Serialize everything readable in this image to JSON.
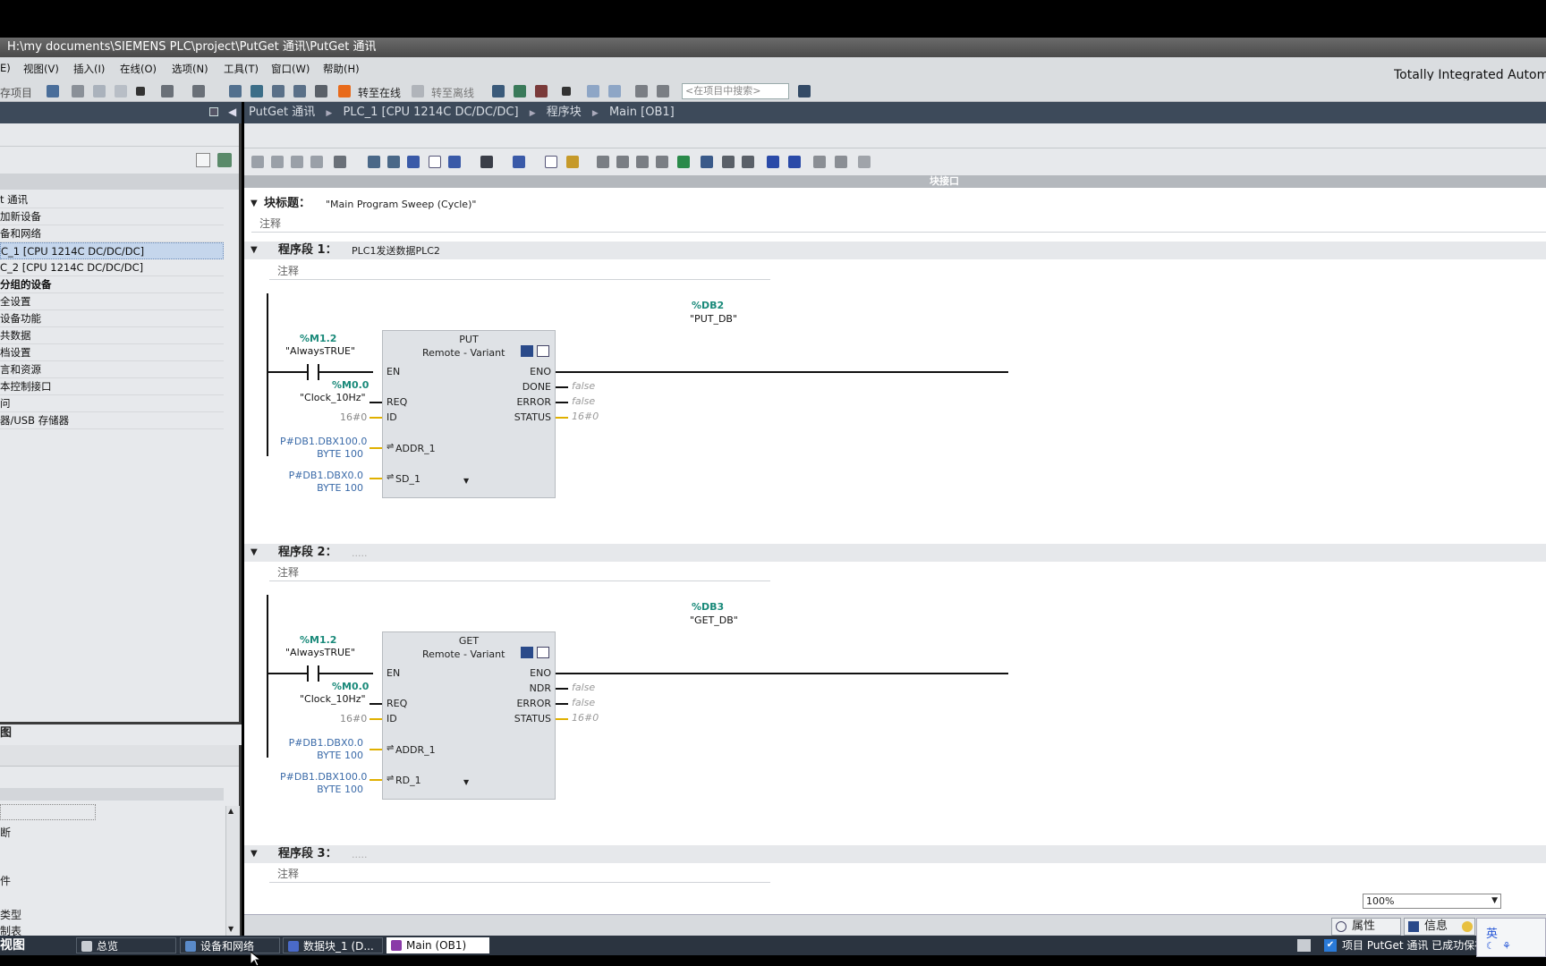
{
  "window": {
    "title": "H:\\my documents\\SIEMENS PLC\\project\\PutGet 通讯\\PutGet 通讯",
    "brand": "Totally Integrated Automation"
  },
  "menu": [
    "E)",
    "视图(V)",
    "插入(I)",
    "在线(O)",
    "选项(N)",
    "工具(T)",
    "窗口(W)",
    "帮助(H)"
  ],
  "toolbar": {
    "save_project": "存项目",
    "go_online": "转至在线",
    "go_offline": "转至离线",
    "search_placeholder": "<在项目中搜索>"
  },
  "breadcrumb": [
    "PutGet 通讯",
    "PLC_1 [CPU 1214C DC/DC/DC]",
    "程序块",
    "Main [OB1]"
  ],
  "tree": [
    {
      "label": "t 通讯"
    },
    {
      "label": "加新设备"
    },
    {
      "label": "备和网络"
    },
    {
      "label": "C_1 [CPU 1214C DC/DC/DC]",
      "selected": true
    },
    {
      "label": "C_2 [CPU 1214C DC/DC/DC]"
    },
    {
      "label": "分组的设备",
      "bold": true
    },
    {
      "label": "全设置"
    },
    {
      "label": "设备功能"
    },
    {
      "label": "共数据"
    },
    {
      "label": "档设置"
    },
    {
      "label": "言和资源"
    },
    {
      "label": "本控制接口"
    },
    {
      "label": "问"
    },
    {
      "label": "器/USB 存储器"
    }
  ],
  "details": {
    "title": "图",
    "rows": [
      "断",
      "件",
      "类型",
      "制表"
    ]
  },
  "editor": {
    "interface_label": "块接口",
    "block_title_label": "块标题：",
    "block_title_value": "\"Main Program Sweep (Cycle)\"",
    "comment": "注释",
    "networks": [
      {
        "label": "程序段 1：",
        "title": "PLC1发送数据PLC2",
        "comment": "注释",
        "db_addr": "%DB2",
        "db_name": "\"PUT_DB\"",
        "block": "PUT",
        "remote": "Remote",
        "variant": "Variant",
        "contact_addr": "%M1.2",
        "contact_name": "\"AlwaysTRUE\"",
        "req_addr": "%M0.0",
        "req_name": "\"Clock_10Hz\"",
        "id_val": "16#0",
        "in3_l1": "P#DB1.DBX100.0",
        "in3_l2": "BYTE 100",
        "in3_pin": "ADDR_1",
        "in4_l1": "P#DB1.DBX0.0",
        "in4_l2": "BYTE 100",
        "in4_pin": "SD_1",
        "out2_pin": "DONE",
        "out2_val": "false",
        "out3_val": "false",
        "out4_val": "16#0"
      },
      {
        "label": "程序段 2：",
        "title": ".....",
        "comment": "注释",
        "db_addr": "%DB3",
        "db_name": "\"GET_DB\"",
        "block": "GET",
        "remote": "Remote",
        "variant": "Variant",
        "contact_addr": "%M1.2",
        "contact_name": "\"AlwaysTRUE\"",
        "req_addr": "%M0.0",
        "req_name": "\"Clock_10Hz\"",
        "id_val": "16#0",
        "in3_l1": "P#DB1.DBX0.0",
        "in3_l2": "BYTE 100",
        "in3_pin": "ADDR_1",
        "in4_l1": "P#DB1.DBX100.0",
        "in4_l2": "BYTE 100",
        "in4_pin": "RD_1",
        "out2_pin": "NDR",
        "out2_val": "false",
        "out3_val": "false",
        "out4_val": "16#0"
      },
      {
        "label": "程序段 3：",
        "title": ".....",
        "comment": "注释"
      }
    ],
    "pins": {
      "en": "EN",
      "eno": "ENO",
      "req": "REQ",
      "id": "ID",
      "error": "ERROR",
      "status": "STATUS",
      "dash": "-"
    }
  },
  "zoom": "100%",
  "inspector": {
    "properties": "属性",
    "info": "信息"
  },
  "bottom": {
    "portal_view": "视图",
    "tabs": [
      "总览",
      "设备和网络",
      "数据块_1 (D...",
      "Main (OB1)"
    ],
    "status": "项目 PutGet 通讯 已成功保存",
    "ime": "英"
  },
  "colors": {
    "accent": "#1a8a7a",
    "wire_yellow": "#e0b000",
    "header": "#3d4a5a"
  }
}
